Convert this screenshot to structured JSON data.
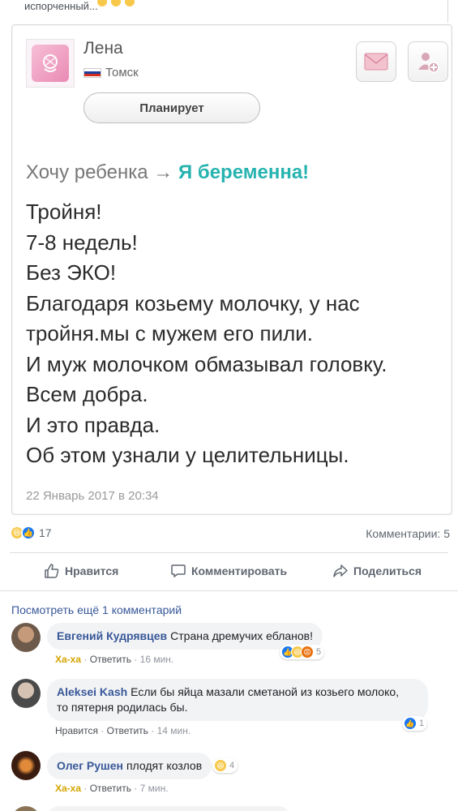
{
  "top": {
    "truncated_text": "испорченный..."
  },
  "profile": {
    "name": "Лена",
    "city": "Томск",
    "status_button": "Планирует",
    "flag_colors": [
      "#ffffff",
      "#1c3f9e",
      "#d52b1e"
    ]
  },
  "post": {
    "status_from": "Хочу ребенка",
    "arrow": "→",
    "status_to": "Я беременна!",
    "lines": [
      "Тройня!",
      "7-8 недель!",
      "Без ЭКО!",
      "Благодаря козьему молочку, у нас",
      "тройня.мы с мужем его пили.",
      "И муж молочком обмазывал головку.",
      "Всем добра.",
      "И это правда.",
      "Об этом узнали у целительницы."
    ],
    "date": "22 Январь 2017 в 20:34"
  },
  "stats": {
    "reactions_count": "17",
    "comments_label": "Комментарии: 5"
  },
  "actions": {
    "like": "Нравится",
    "comment": "Комментировать",
    "share": "Поделиться"
  },
  "more_comments": "Посмотреть ещё 1 комментарий",
  "comments": [
    {
      "author": "Евгений Кудрявцев",
      "text": "Страна дремучих ебланов!",
      "reaction_label": "Ха-ха",
      "reply_label": "Ответить",
      "time": "16 мин.",
      "react_count": "5"
    },
    {
      "author": "Aleksei Kash",
      "text": "Если бы яйца мазали сметаной из козьего молоко,",
      "text2": "то пятерня родилась бы.",
      "like_label": "Нравится",
      "reply_label": "Ответить",
      "time": "14 мин.",
      "react_count": "1"
    },
    {
      "author": "Олег Рушен",
      "text": "плодят козлов",
      "reaction_label": "Ха-ха",
      "reply_label": "Ответить",
      "time": "7 мин.",
      "react_count": "4"
    }
  ],
  "colors": {
    "link_blue": "#385898",
    "facebook_blue": "#1877f2",
    "status_teal": "#27b3b0",
    "haha_yellow": "#f7c84a",
    "angry_orange": "#e9710f"
  }
}
